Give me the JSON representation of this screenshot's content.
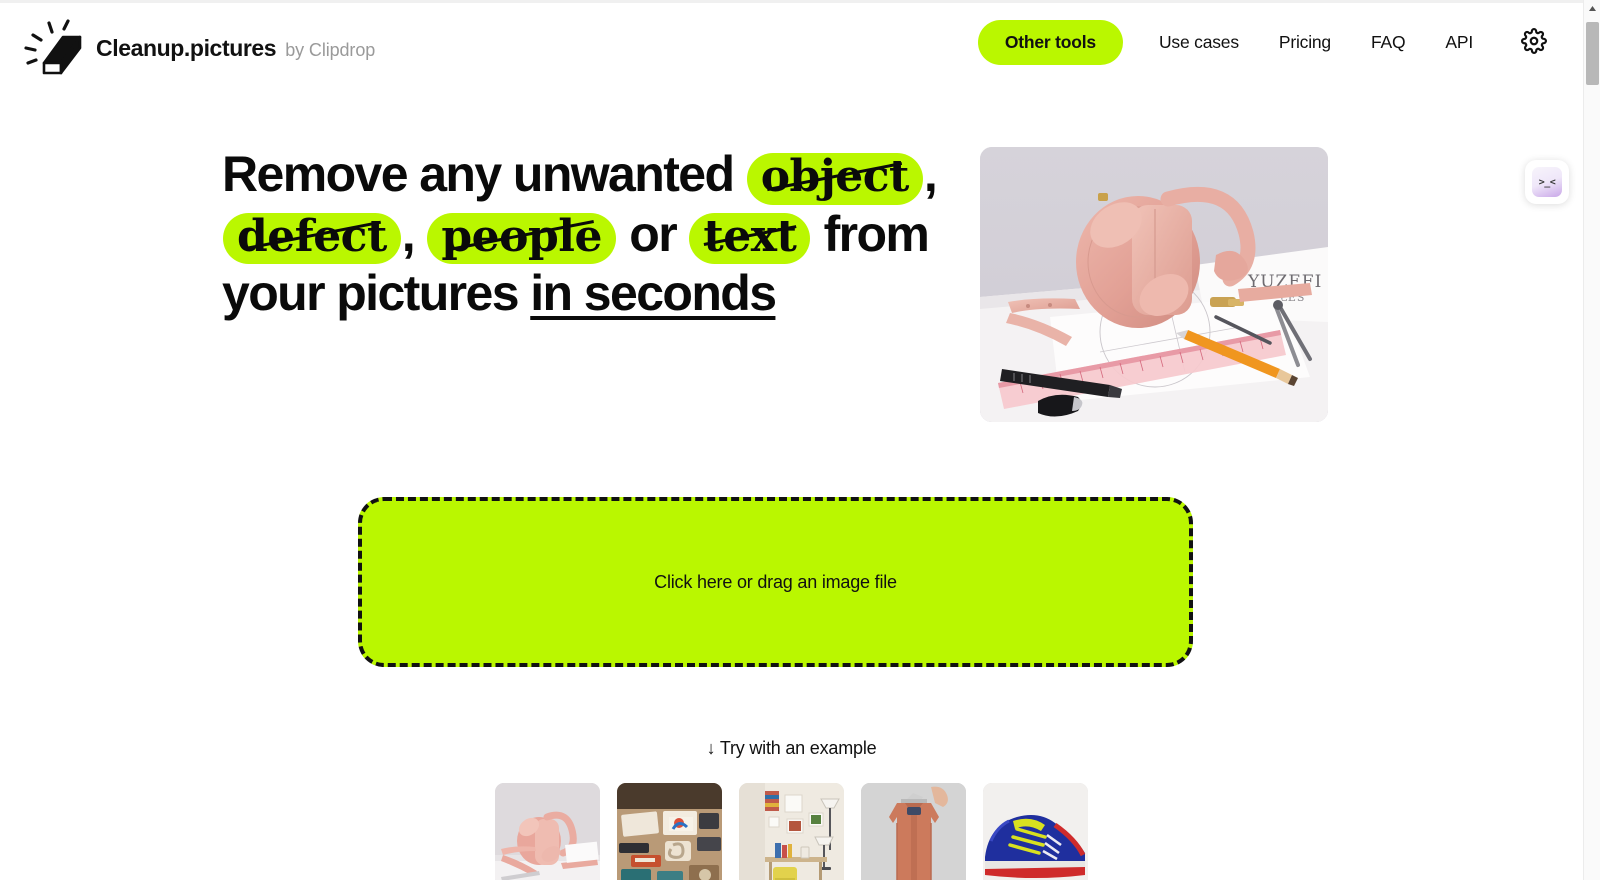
{
  "brand": {
    "logo_icon": "eraser-icon",
    "name": "Cleanup.pictures",
    "byline": "by Clipdrop"
  },
  "nav": {
    "pill_label": "Other tools",
    "links": [
      {
        "label": "Use cases"
      },
      {
        "label": "Pricing"
      },
      {
        "label": "FAQ"
      },
      {
        "label": "API"
      }
    ],
    "settings_icon": "gear-icon"
  },
  "hero": {
    "headline": {
      "part1": "Remove any unwanted",
      "highlight1": "object",
      "comma1": ",",
      "highlight2": "defect",
      "comma2": ",",
      "highlight3": "people",
      "part2": "or",
      "highlight4": "text",
      "part3": "from your pictures",
      "underlined": "in seconds"
    },
    "image_alt": "pink-handbag-on-design-desk"
  },
  "dropzone": {
    "label": "Click here or drag an image file"
  },
  "examples": {
    "title": "↓ Try with an example",
    "thumbnails": [
      {
        "name": "pink-handbag"
      },
      {
        "name": "cluttered-desk"
      },
      {
        "name": "room-with-floor-lamp"
      },
      {
        "name": "salmon-jacket"
      },
      {
        "name": "blue-sneaker"
      }
    ]
  },
  "feedback_widget": {
    "face": ">_<"
  },
  "colors": {
    "accent_green": "#baf700",
    "text": "#111111",
    "muted": "#9a9a9a",
    "scrollbar_thumb": "#b8b8b8"
  }
}
